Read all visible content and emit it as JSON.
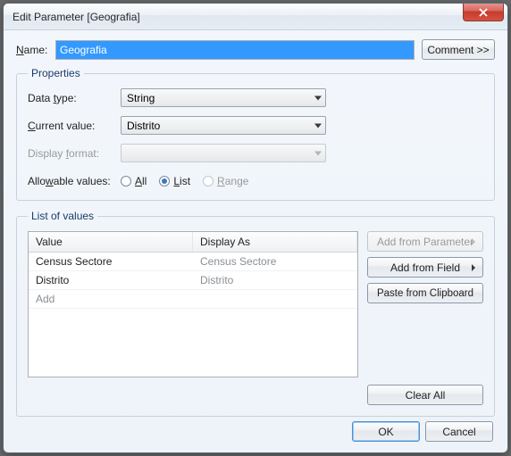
{
  "window": {
    "title": "Edit Parameter [Geografia]"
  },
  "name": {
    "label": "Name:",
    "value": "Geografia",
    "comment_btn": "Comment >>"
  },
  "properties": {
    "legend": "Properties",
    "data_type": {
      "label": "Data type:",
      "value": "String"
    },
    "current_value": {
      "label": "Current value:",
      "value": "Distrito"
    },
    "display_format": {
      "label": "Display format:",
      "value": ""
    },
    "allowable": {
      "label": "Allowable values:",
      "all": "All",
      "list": "List",
      "range": "Range"
    }
  },
  "list_of_values": {
    "legend": "List of values",
    "col_value": "Value",
    "col_display": "Display As",
    "rows": [
      {
        "value": "Census Sectore",
        "display": "Census Sectore"
      },
      {
        "value": "Distrito",
        "display": "Distrito"
      }
    ],
    "add_placeholder": "Add",
    "side": {
      "add_param": "Add from Parameter",
      "add_field": "Add from Field",
      "paste": "Paste from Clipboard",
      "clear": "Clear All"
    }
  },
  "footer": {
    "ok": "OK",
    "cancel": "Cancel"
  }
}
